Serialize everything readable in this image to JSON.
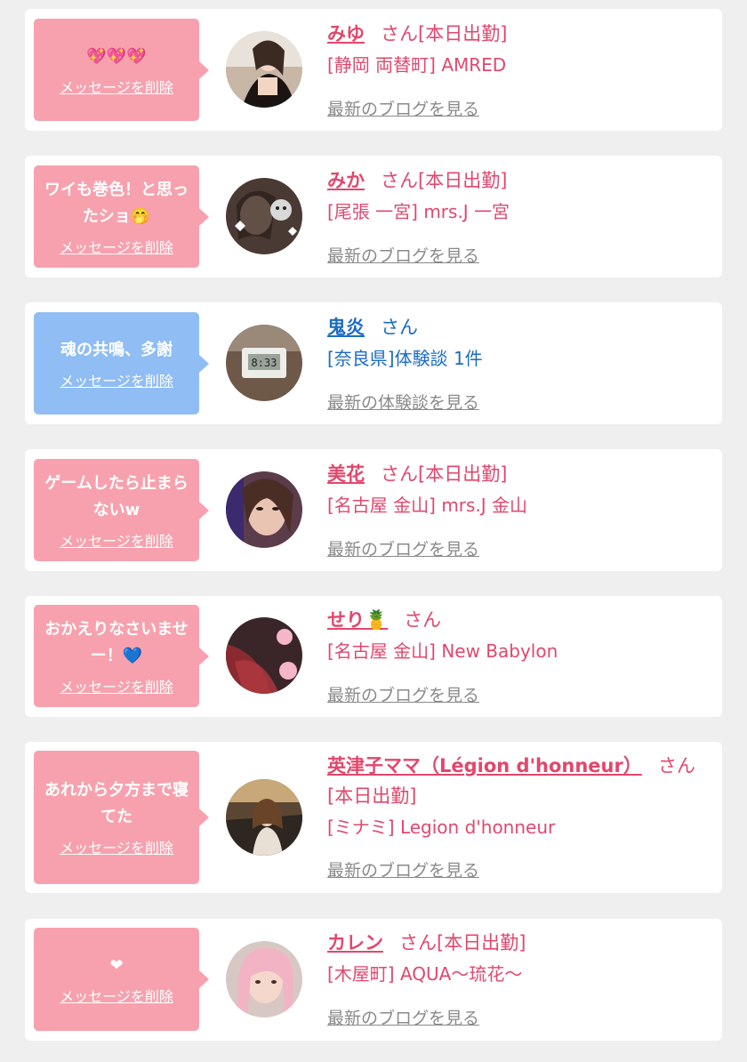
{
  "delete_label": "メッセージを削除",
  "suffix": "さん",
  "cards": [
    {
      "message": "💖💖💖",
      "name": "みゆ",
      "status": "[本日出勤]",
      "shop": "[静岡 両替町] AMRED",
      "link": "最新のブログを見る",
      "color": "pink"
    },
    {
      "message": "ワイも巻色！と思ったショ🤭",
      "name": "みか",
      "status": "[本日出勤]",
      "shop": "[尾張 一宮] mrs.J 一宮",
      "link": "最新のブログを見る",
      "color": "pink"
    },
    {
      "message": "魂の共鳴、多謝",
      "name": "鬼炎",
      "status": "",
      "shop": "[奈良県]体験談 1件",
      "link": "最新の体験談を見る",
      "color": "blue"
    },
    {
      "message": "ゲームしたら止まらないw",
      "name": "美花",
      "status": "[本日出勤]",
      "shop": "[名古屋 金山] mrs.J 金山",
      "link": "最新のブログを見る",
      "color": "pink"
    },
    {
      "message": "おかえりなさいませー！💙",
      "name": "せり🍍",
      "status": "",
      "shop": "[名古屋 金山] New Babylon",
      "link": "最新のブログを見る",
      "color": "pink"
    },
    {
      "message": "あれから夕方まで寝てた",
      "name": "英津子ママ（Légion d'honneur）",
      "status": "[本日出勤]",
      "shop": "[ミナミ] Legion d'honneur",
      "link": "最新のブログを見る",
      "color": "pink"
    },
    {
      "message": "❤",
      "name": "カレン",
      "status": "[本日出勤]",
      "shop": "[木屋町] AQUA～琉花～",
      "link": "最新のブログを見る",
      "color": "pink"
    }
  ],
  "colors": {
    "pink_bubble": "#f7a1ae",
    "blue_bubble": "#8fbdf4",
    "pink_text": "#e2476c",
    "blue_text": "#1c6cc4",
    "link_gray": "#8a8a8a"
  }
}
